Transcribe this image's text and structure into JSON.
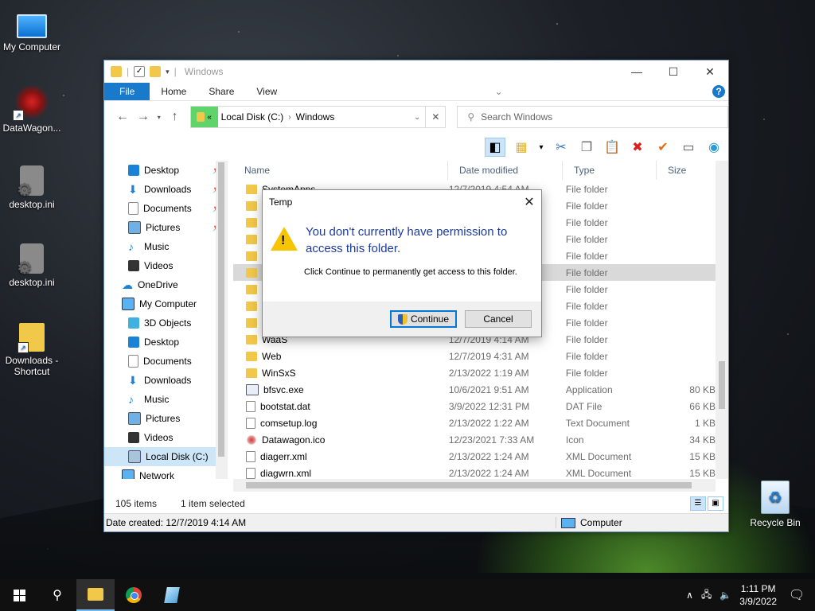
{
  "desktop": {
    "icons": [
      {
        "label": "My Computer"
      },
      {
        "label": "DataWagon..."
      },
      {
        "label": "desktop.ini"
      },
      {
        "label": "desktop.ini"
      },
      {
        "label": "Downloads - Shortcut"
      },
      {
        "label": "Recycle Bin"
      }
    ]
  },
  "window": {
    "title": "Windows",
    "ribbon_tabs": [
      "File",
      "Home",
      "Share",
      "View"
    ],
    "address": {
      "highlight": "«",
      "crumbs": [
        "Local Disk (C:)",
        "Windows"
      ]
    },
    "search_placeholder": "Search Windows",
    "nav": [
      {
        "label": "Desktop",
        "icon": "desk",
        "pinned": true
      },
      {
        "label": "Downloads",
        "icon": "down",
        "pinned": true
      },
      {
        "label": "Documents",
        "icon": "doc",
        "pinned": true
      },
      {
        "label": "Pictures",
        "icon": "pic",
        "pinned": true
      },
      {
        "label": "Music",
        "icon": "mus",
        "pinned": false
      },
      {
        "label": "Videos",
        "icon": "vid",
        "pinned": false
      },
      {
        "label": "OneDrive",
        "icon": "cloud",
        "pinned": false,
        "level0": true
      },
      {
        "label": "My Computer",
        "icon": "pc",
        "pinned": false,
        "level0": true
      },
      {
        "label": "3D Objects",
        "icon": "cube",
        "pinned": false
      },
      {
        "label": "Desktop",
        "icon": "desk",
        "pinned": false
      },
      {
        "label": "Documents",
        "icon": "doc",
        "pinned": false
      },
      {
        "label": "Downloads",
        "icon": "down",
        "pinned": false
      },
      {
        "label": "Music",
        "icon": "mus",
        "pinned": false
      },
      {
        "label": "Pictures",
        "icon": "pic",
        "pinned": false
      },
      {
        "label": "Videos",
        "icon": "vid",
        "pinned": false
      },
      {
        "label": "Local Disk (C:)",
        "icon": "drive",
        "pinned": false,
        "selected": true
      },
      {
        "label": "Network",
        "icon": "pc",
        "pinned": false,
        "level0": true
      }
    ],
    "columns": [
      "Name",
      "Date modified",
      "Type",
      "Size"
    ],
    "files": [
      {
        "name": "SystemApps",
        "date": "12/7/2019 4:54 AM",
        "type": "File folder",
        "size": "",
        "kind": "folder"
      },
      {
        "name": "",
        "date": "",
        "type": "File folder",
        "size": "",
        "kind": "folder"
      },
      {
        "name": "",
        "date": "",
        "type": "File folder",
        "size": "",
        "kind": "folder"
      },
      {
        "name": "",
        "date": "",
        "type": "File folder",
        "size": "",
        "kind": "folder"
      },
      {
        "name": "",
        "date": "",
        "type": "File folder",
        "size": "",
        "kind": "folder"
      },
      {
        "name": "",
        "date": "",
        "type": "File folder",
        "size": "",
        "kind": "folder",
        "selected": true
      },
      {
        "name": "",
        "date": "",
        "type": "File folder",
        "size": "",
        "kind": "folder"
      },
      {
        "name": "",
        "date": "",
        "type": "File folder",
        "size": "",
        "kind": "folder"
      },
      {
        "name": "",
        "date": "",
        "type": "File folder",
        "size": "",
        "kind": "folder"
      },
      {
        "name": "WaaS",
        "date": "12/7/2019 4:14 AM",
        "type": "File folder",
        "size": "",
        "kind": "folder"
      },
      {
        "name": "Web",
        "date": "12/7/2019 4:31 AM",
        "type": "File folder",
        "size": "",
        "kind": "folder"
      },
      {
        "name": "WinSxS",
        "date": "2/13/2022 1:19 AM",
        "type": "File folder",
        "size": "",
        "kind": "folder"
      },
      {
        "name": "bfsvc.exe",
        "date": "10/6/2021 9:51 AM",
        "type": "Application",
        "size": "80 KB",
        "kind": "exe"
      },
      {
        "name": "bootstat.dat",
        "date": "3/9/2022 12:31 PM",
        "type": "DAT File",
        "size": "66 KB",
        "kind": "txt"
      },
      {
        "name": "comsetup.log",
        "date": "2/13/2022 1:22 AM",
        "type": "Text Document",
        "size": "1 KB",
        "kind": "txt"
      },
      {
        "name": "Datawagon.ico",
        "date": "12/23/2021 7:33 AM",
        "type": "Icon",
        "size": "34 KB",
        "kind": "ico"
      },
      {
        "name": "diagerr.xml",
        "date": "2/13/2022 1:24 AM",
        "type": "XML Document",
        "size": "15 KB",
        "kind": "txt"
      },
      {
        "name": "diagwrn.xml",
        "date": "2/13/2022 1:24 AM",
        "type": "XML Document",
        "size": "15 KB",
        "kind": "txt"
      }
    ],
    "status": {
      "count": "105 items",
      "selected": "1 item selected"
    },
    "details": {
      "left": "Date created: 12/7/2019 4:14 AM",
      "right": "Computer"
    }
  },
  "dialog": {
    "title": "Temp",
    "heading": "You don't currently have permission to access this folder.",
    "text": "Click Continue to permanently get access to this folder.",
    "continue_label": "Continue",
    "cancel_label": "Cancel"
  },
  "taskbar": {
    "time": "1:11 PM",
    "date": "3/9/2022"
  }
}
